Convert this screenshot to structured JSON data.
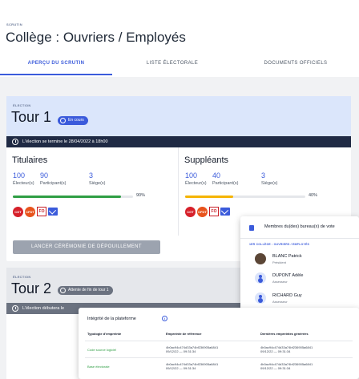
{
  "header": {
    "scrutin_label": "SCRUTIN",
    "title": "Collège : Ouvriers / Employés"
  },
  "tabs": [
    {
      "label": "APERÇU DU SCRUTIN",
      "active": true
    },
    {
      "label": "LISTE ÉLECTORALE",
      "active": false
    },
    {
      "label": "DOCUMENTS OFFICIELS",
      "active": false
    }
  ],
  "election1": {
    "label": "ÉLECTION",
    "title": "Tour 1",
    "badge": "En cours",
    "info": "L'élection se termine le 28/04/2022 à 18h00",
    "titulaires": {
      "title": "Titulaires",
      "electeurs": "100",
      "electeurs_label": "Électeur(s)",
      "participants": "90",
      "participants_label": "Participant(s)",
      "sieges": "3",
      "sieges_label": "Siège(s)",
      "progress": 90,
      "progress_label": "90%",
      "progress_color": "#2f9e44"
    },
    "suppleants": {
      "title": "Suppléants",
      "electeurs": "100",
      "electeurs_label": "Électeur(s)",
      "participants": "40",
      "participants_label": "Participant(s)",
      "sieges": "3",
      "sieges_label": "Siège(s)",
      "progress": 40,
      "progress_label": "40%",
      "progress_color": "#f5b400"
    },
    "logos": [
      "CGT",
      "CFDT",
      "FO",
      "mail-icon"
    ],
    "button": "LANCER CÉRÉMONIE DE DÉPOUILLEMENT"
  },
  "election2": {
    "label": "ÉLECTION",
    "title": "Tour 2",
    "badge": "Attente de fin de tour 1",
    "info": "L'élection débutera le"
  },
  "bureau": {
    "title": "Membres du(des) bureau(x) de vote",
    "section": "1ER COLLÈGE : OUVRIERS / EMPLOYÉS",
    "members": [
      {
        "name": "BLANC Patrick",
        "role": "Président"
      },
      {
        "name": "DUPONT Adèle",
        "role": "Assesseur"
      },
      {
        "name": "RICHARD Guy",
        "role": "Assesseur"
      }
    ]
  },
  "integrite": {
    "title": "Intégrité de la plateforme",
    "headers": [
      "Typologie d'empreinte",
      "Empreinte de référence",
      "Dernières empreintes générées"
    ],
    "rows": [
      {
        "type": "Code source logiciel",
        "ref_hash": "4b0ac94c474d33a74bf236905a6841",
        "ref_date": "09/12/22 — 09:31:34",
        "last_hash": "4b0ac94c474d33a74bf236905a6841",
        "last_date": "09/12/22 — 09:31:34"
      },
      {
        "type": "Base électorale",
        "ref_hash": "4b0ac94c474d33a74bf236905a6841",
        "ref_date": "09/12/22 — 09:31:34",
        "last_hash": "4b0ac94c474d33a74bf236905a6841",
        "last_date": "09/12/22 — 09:31:34"
      }
    ]
  }
}
